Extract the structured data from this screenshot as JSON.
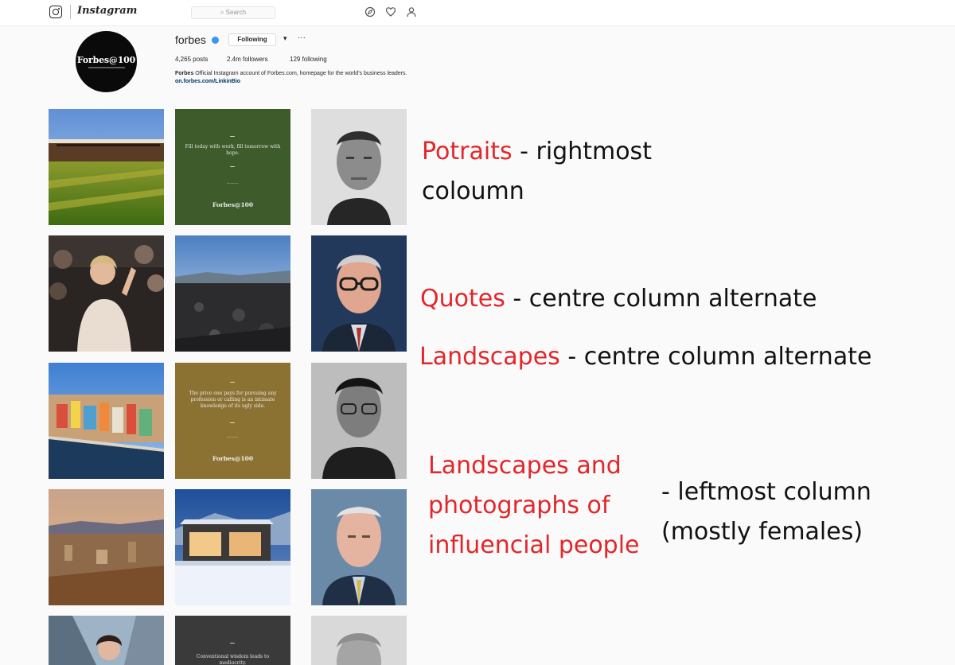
{
  "nav": {
    "wordmark": "Instagram",
    "search_placeholder": "Search",
    "icons": [
      "camera-icon",
      "compass-icon",
      "heart-icon",
      "person-icon"
    ]
  },
  "profile": {
    "username": "forbes",
    "avatar_text": "Forbes@100",
    "following_button": "Following",
    "caret": "▾",
    "more": "···",
    "posts": "4,265 posts",
    "followers": "2.4m followers",
    "following": "129 following",
    "bio_name": "Forbes",
    "bio_text": " Official Instagram account of Forbes.com, homepage for the world's business leaders. ",
    "bio_link": "on.forbes.com/LinkinBio"
  },
  "grid": {
    "quote_brand": "Forbes@100",
    "quote_1": "Fill today with work, fill tomorrow with hope.",
    "quote_2": "The price one pays for pursuing any profession or calling is an intimate knowledge of its ugly side.",
    "quote_3": "Conventional wisdom leads to mediocrity."
  },
  "annotations": {
    "portraits_label": "Potraits",
    "portraits_desc_1": " - rightmost",
    "portraits_desc_2": "coloumn",
    "quotes_label": "Quotes",
    "quotes_desc": " - centre column alternate",
    "landscapes_label": "Landscapes",
    "landscapes_desc": " - centre column alternate",
    "left_label_1": "Landscapes and",
    "left_label_2": "photographs of",
    "left_label_3": "influencial people",
    "left_desc_1": "- leftmost column",
    "left_desc_2": "(mostly females)"
  },
  "colors": {
    "annotation_red": "#e3262a",
    "quote_green": "#3e5b2b",
    "quote_gold": "#8b7233",
    "quote_dark": "#3a3a3a",
    "verified_blue": "#3897f0"
  }
}
